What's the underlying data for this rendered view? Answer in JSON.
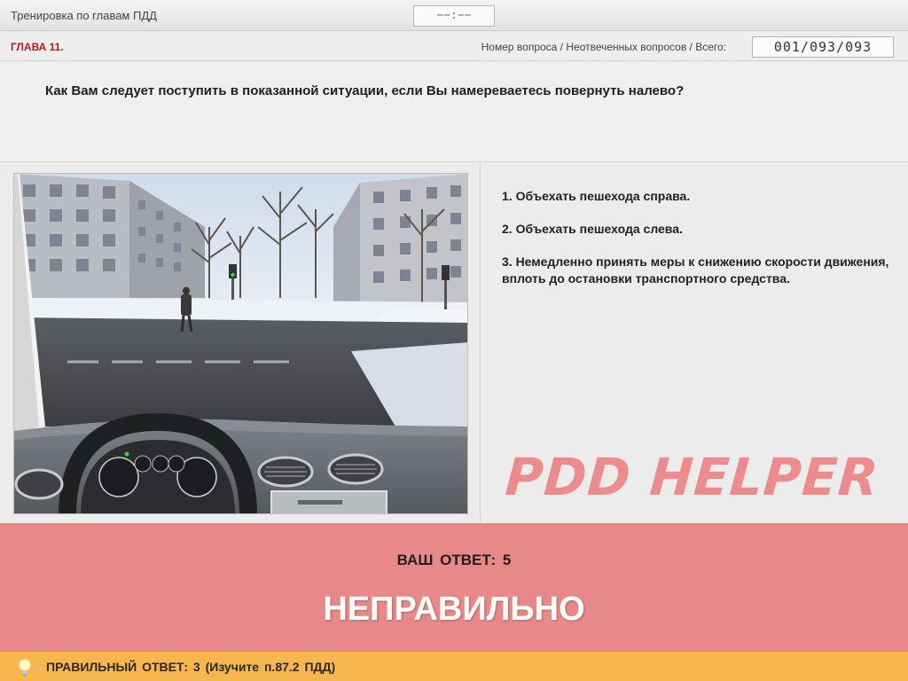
{
  "header": {
    "title": "Тренировка по главам ПДД",
    "timer": "−−:−−"
  },
  "chapter_bar": {
    "chapter": "ГЛАВА 11.",
    "qnum_label": "Номер вопроса / Неотвеченных вопросов / Всего:",
    "qnum_value": "001/093/093"
  },
  "question": {
    "text": "Как Вам следует поступить в показанной ситуации, если Вы намереваетесь повернуть налево?"
  },
  "answers": [
    {
      "label": "1.  Объехать пешехода справа."
    },
    {
      "label": "2.  Объехать пешехода слева."
    },
    {
      "label": "3.  Немедленно принять меры к снижению скорости движения, вплоть до остановки транспортного средства."
    }
  ],
  "watermark": "PDD HELPER",
  "result": {
    "your_answer": "ВАШ  ОТВЕТ:   5",
    "verdict": "НЕПРАВИЛЬНО"
  },
  "correct": {
    "text": "ПРАВИЛЬНЫЙ ОТВЕТ:   3   (Изучите п.87.2 ПДД)"
  },
  "colors": {
    "result_bg": "#e98888",
    "correct_bg": "#f7b74e",
    "chapter_red": "#b21d1d",
    "watermark": "#ec8c8c"
  }
}
